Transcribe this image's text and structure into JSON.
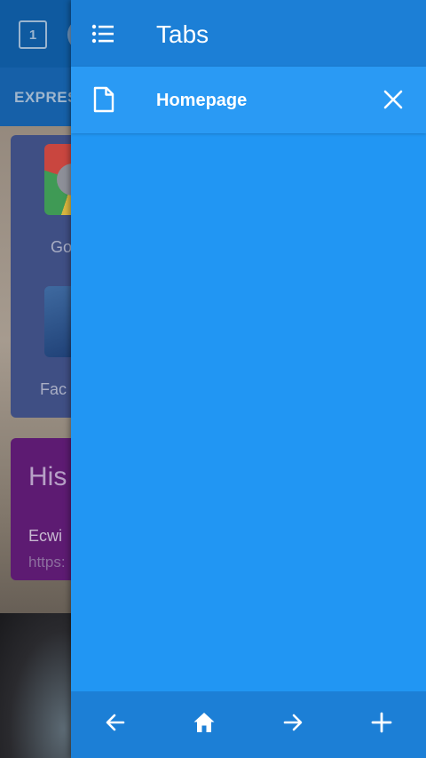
{
  "background_page": {
    "tab_count": "1",
    "nav_text": "EXPRESS",
    "speed_dial_1": "Go",
    "speed_dial_2": "Fac",
    "history_title": "His",
    "history_item": "Ecwi",
    "history_url": "https:"
  },
  "drawer": {
    "header": {
      "title": "Tabs",
      "menu_icon": "list-icon"
    },
    "tabs": [
      {
        "title": "Homepage",
        "icon": "document-icon",
        "close_icon": "close-icon"
      }
    ],
    "footer": {
      "back_icon": "arrow-left-icon",
      "home_icon": "home-icon",
      "forward_icon": "arrow-right-icon",
      "new_tab_icon": "plus-icon"
    }
  },
  "colors": {
    "drawer_bg": "#2196f3",
    "drawer_bars": "#1c7fd6",
    "icon": "#ffffff"
  }
}
